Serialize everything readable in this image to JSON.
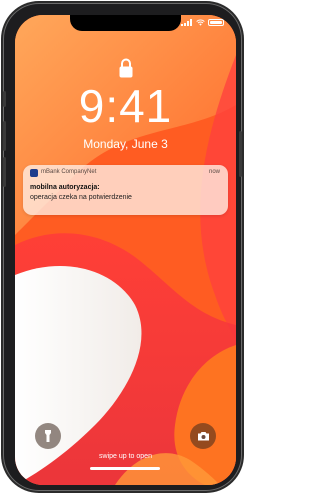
{
  "lockscreen": {
    "time": "9:41",
    "date": "Monday, June 3",
    "swipe_hint": "swipe up to open"
  },
  "notification": {
    "app_name": "mBank CompanyNet",
    "when": "now",
    "title": "mobilna autoryzacja:",
    "body": "operacja czeka na potwierdzenie"
  },
  "icons": {
    "lock": "lock-icon",
    "flashlight": "flashlight-icon",
    "camera": "camera-icon",
    "signal": "signal-icon",
    "wifi": "wifi-icon",
    "battery": "battery-icon"
  },
  "colors": {
    "wallpaper_primary": "#ff5a1f",
    "notification_bg": "#ffece2",
    "app_icon": "#1e3c8c"
  }
}
